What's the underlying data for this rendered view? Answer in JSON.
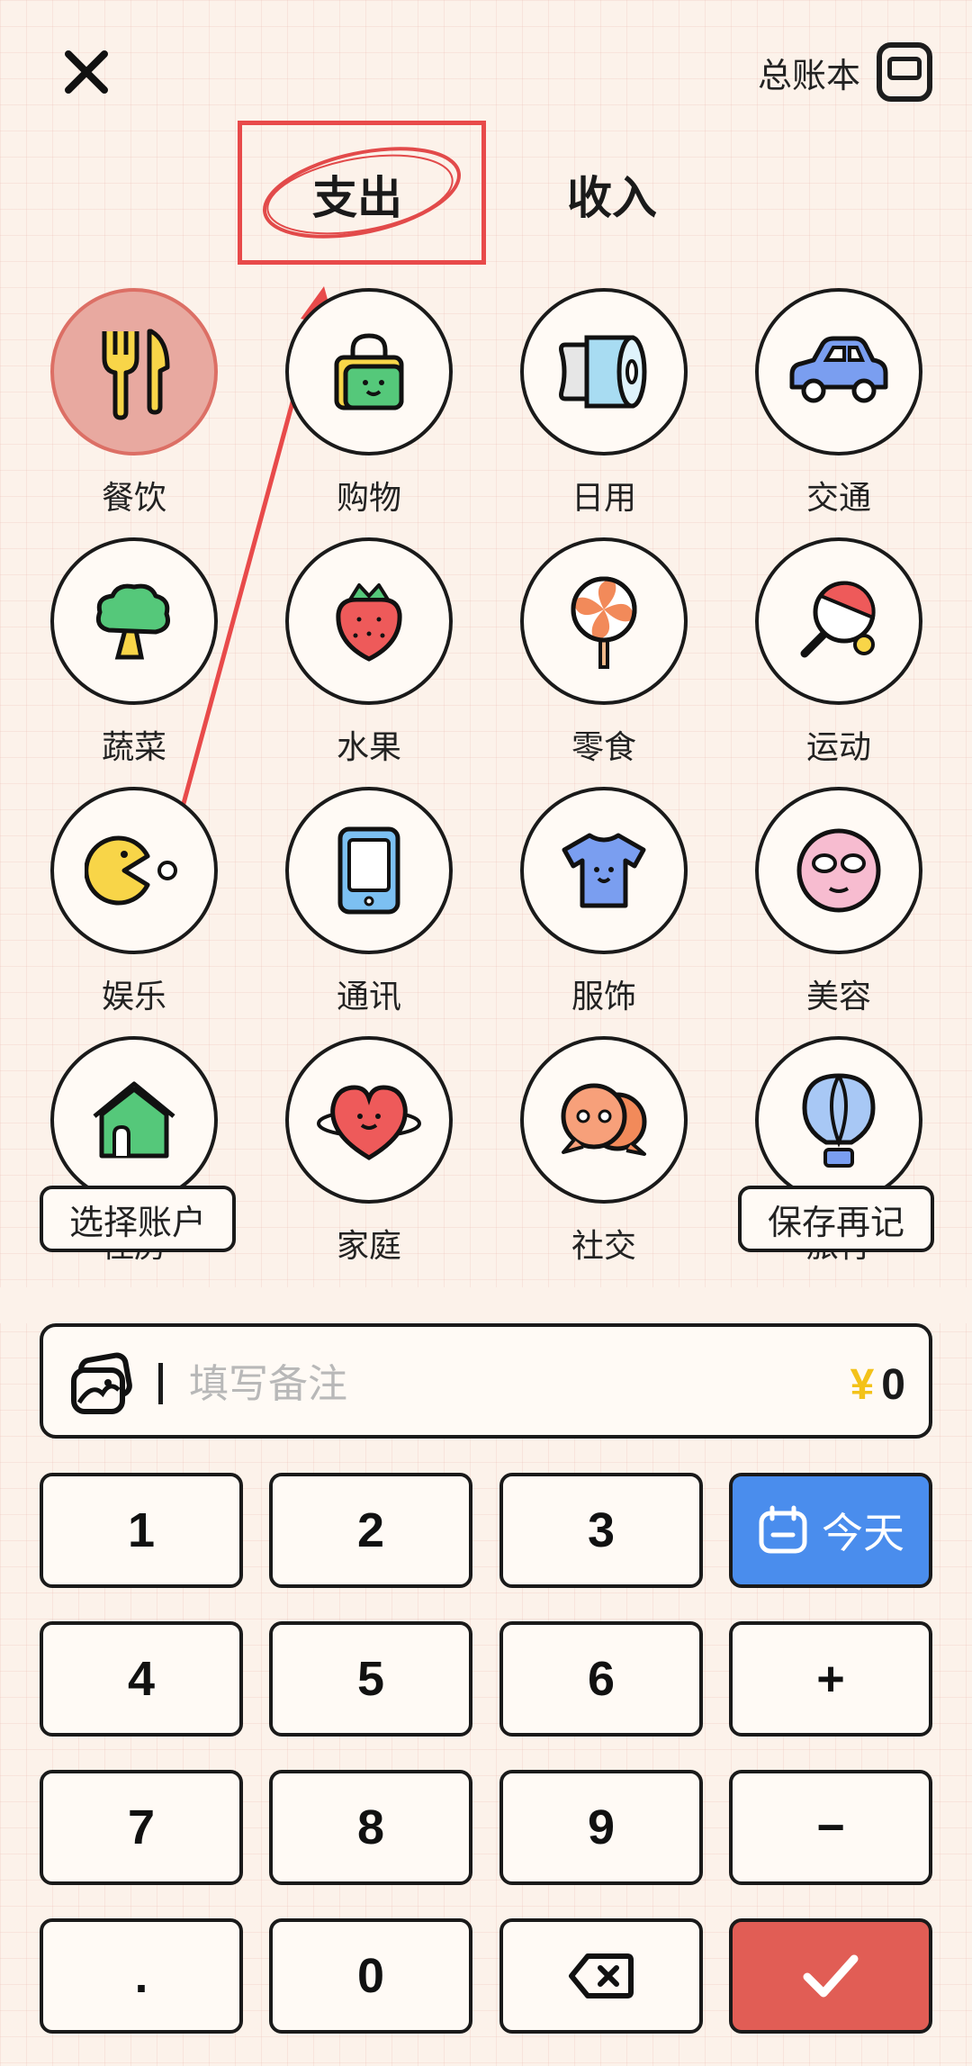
{
  "header": {
    "ledger_label": "总账本"
  },
  "tabs": {
    "expense": "支出",
    "income": "收入"
  },
  "categories": [
    {
      "label": "餐饮",
      "icon": "fork-knife-icon",
      "selected": true
    },
    {
      "label": "购物",
      "icon": "shopping-bag-icon",
      "selected": false
    },
    {
      "label": "日用",
      "icon": "paper-roll-icon",
      "selected": false
    },
    {
      "label": "交通",
      "icon": "car-icon",
      "selected": false
    },
    {
      "label": "蔬菜",
      "icon": "broccoli-icon",
      "selected": false
    },
    {
      "label": "水果",
      "icon": "strawberry-icon",
      "selected": false
    },
    {
      "label": "零食",
      "icon": "lollipop-icon",
      "selected": false
    },
    {
      "label": "运动",
      "icon": "ping-pong-icon",
      "selected": false
    },
    {
      "label": "娱乐",
      "icon": "pacman-icon",
      "selected": false
    },
    {
      "label": "通讯",
      "icon": "phone-icon",
      "selected": false
    },
    {
      "label": "服饰",
      "icon": "tshirt-icon",
      "selected": false
    },
    {
      "label": "美容",
      "icon": "face-mask-icon",
      "selected": false
    },
    {
      "label": "住房",
      "icon": "house-icon",
      "selected": false
    },
    {
      "label": "家庭",
      "icon": "heart-icon",
      "selected": false
    },
    {
      "label": "社交",
      "icon": "chat-bubbles-icon",
      "selected": false
    },
    {
      "label": "旅行",
      "icon": "hot-air-balloon-icon",
      "selected": false
    }
  ],
  "actions": {
    "choose_account": "选择账户",
    "save_again": "保存再记"
  },
  "note": {
    "placeholder": "填写备注",
    "currency": "¥",
    "amount": "0"
  },
  "keypad": {
    "k1": "1",
    "k2": "2",
    "k3": "3",
    "today": "今天",
    "k4": "4",
    "k5": "5",
    "k6": "6",
    "plus": "+",
    "k7": "7",
    "k8": "8",
    "k9": "9",
    "minus": "−",
    "dot": ".",
    "k0": "0"
  },
  "colors": {
    "accent_red": "#e15d55",
    "today_blue": "#4a8ded",
    "annotation": "#e84a4a",
    "selected_bg": "#e8a9a0"
  }
}
